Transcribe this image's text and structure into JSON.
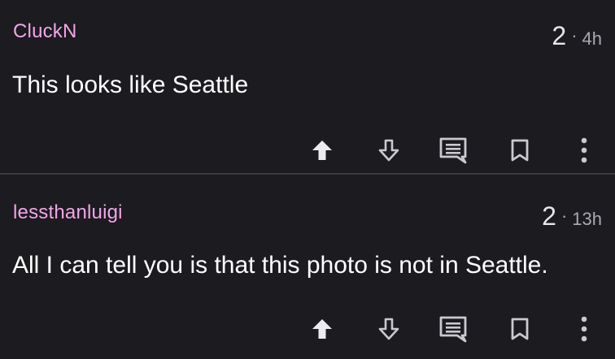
{
  "comments": [
    {
      "username": "CluckN",
      "score": "2",
      "separator": "·",
      "age": "4h",
      "body": "This looks like Seattle"
    },
    {
      "username": "lessthanluigi",
      "score": "2",
      "separator": "·",
      "age": "13h",
      "body": "All I can tell you is that this photo is not in Seattle."
    }
  ],
  "icons": {
    "upvote": "arrow-up-icon",
    "downvote": "arrow-down-outline-icon",
    "reply": "comment-icon",
    "save": "bookmark-icon",
    "more": "vertical-dots-icon"
  },
  "colors": {
    "background": "#1c1b20",
    "username": "#f2a6e6",
    "text": "#ffffff",
    "muted": "#a9a9b0",
    "divider": "#3b3a40",
    "icon": "#d0d0d6"
  }
}
